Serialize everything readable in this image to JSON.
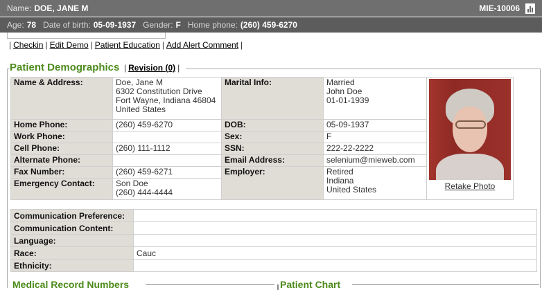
{
  "header": {
    "name_label": "Name:",
    "name_value": "DOE, JANE M",
    "mrn": "MIE-10006",
    "chart_icon": "bar-chart-icon"
  },
  "subheader": {
    "age_label": "Age:",
    "age_value": "78",
    "dob_label": "Date of birth:",
    "dob_value": "05-09-1937",
    "gender_label": "Gender:",
    "gender_value": "F",
    "phone_label": "Home phone:",
    "phone_value": "(260) 459-6270"
  },
  "actions": {
    "checkin": "Checkin",
    "edit_demo": "Edit Demo",
    "patient_education": "Patient Education",
    "add_alert_comment": "Add Alert Comment"
  },
  "demographics": {
    "title": "Patient Demographics",
    "revision": "Revision (0)",
    "name_address_label": "Name & Address:",
    "name_address_lines": [
      "Doe, Jane M",
      "6302 Constitution Drive",
      "Fort Wayne, Indiana 46804",
      "United States"
    ],
    "marital_label": "Marital Info:",
    "marital_lines": [
      "Married",
      "John Doe",
      "01-01-1939"
    ],
    "home_phone_label": "Home Phone:",
    "home_phone": "(260) 459-6270",
    "dob_label": "DOB:",
    "dob": "05-09-1937",
    "work_phone_label": "Work Phone:",
    "work_phone": "",
    "sex_label": "Sex:",
    "sex": "F",
    "cell_phone_label": "Cell Phone:",
    "cell_phone": "(260) 111-1112",
    "ssn_label": "SSN:",
    "ssn": "222-22-2222",
    "alt_phone_label": "Alternate Phone:",
    "alt_phone": "",
    "email_label": "Email Address:",
    "email": "selenium@mieweb.com",
    "fax_label": "Fax Number:",
    "fax": "(260) 459-6271",
    "employer_label": "Employer:",
    "employer_lines": [
      "Retired",
      "Indiana",
      "United States"
    ],
    "emergency_label": "Emergency Contact:",
    "emergency_lines": [
      "Son Doe",
      "(260) 444-4444"
    ],
    "retake_photo": "Retake Photo"
  },
  "communication": {
    "pref_label": "Communication Preference:",
    "pref": "",
    "content_label": "Communication Content:",
    "content": "",
    "language_label": "Language:",
    "language": "",
    "race_label": "Race:",
    "race": "Cauc",
    "ethnicity_label": "Ethnicity:",
    "ethnicity": ""
  },
  "sections": {
    "mrn_title": "Medical Record Numbers",
    "chart_title": "Patient Chart"
  }
}
